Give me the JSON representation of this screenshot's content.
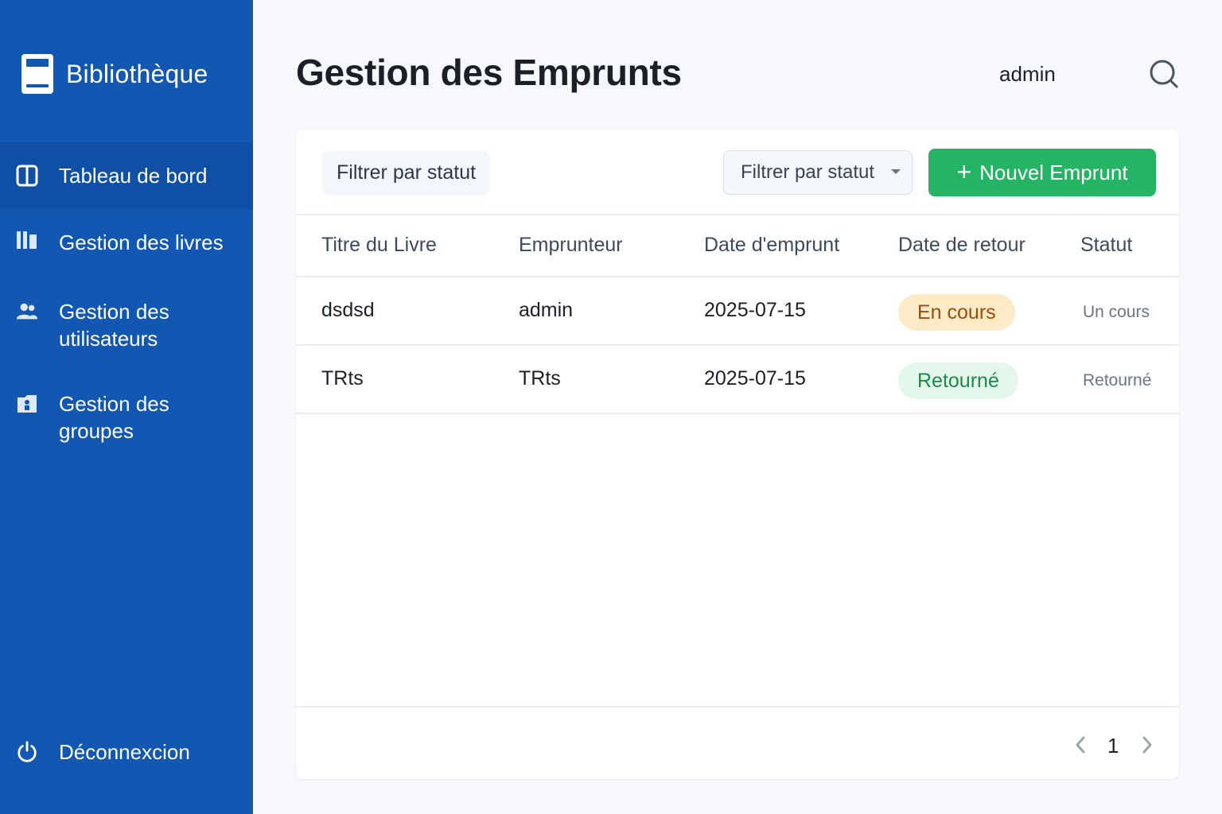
{
  "sidebar": {
    "brand": "Bibliothèque",
    "items": [
      {
        "label": "Tableau de bord",
        "icon": "layout-columns-icon",
        "active": true
      },
      {
        "label": "Gestion des livres",
        "icon": "books-icon"
      },
      {
        "label": "Gestion des\nutilisateurs",
        "icon": "users-icon"
      },
      {
        "label": "Gestion des\ngroupes",
        "icon": "groups-icon"
      }
    ],
    "logout": "Déconnexcion"
  },
  "header": {
    "title": "Gestion des Emprunts",
    "user": "admin"
  },
  "toolbar": {
    "filter_label": "Filtrer par statut",
    "filter_select": "Filtrer par statut",
    "new_button": "Nouvel Emprunt"
  },
  "table": {
    "headers": [
      "Titre du Livre",
      "Emprunteur",
      "Date d'emprunt",
      "Date de retour",
      "Statut"
    ],
    "rows": [
      {
        "title": "dsdsd",
        "borrower": "admin",
        "borrow_date": "2025-07-15",
        "return_badge": "En cours",
        "status": "Un cours"
      },
      {
        "title": "TRts",
        "borrower": "TRts",
        "borrow_date": "2025-07-15",
        "return_badge": "Retourné",
        "status": "Retourné"
      }
    ]
  },
  "pagination": {
    "page": "1"
  },
  "colors": {
    "sidebar": "#1258b3",
    "accent": "#25b364",
    "pending_badge": "#fdebc8",
    "returned_badge": "#e3f7ec"
  }
}
